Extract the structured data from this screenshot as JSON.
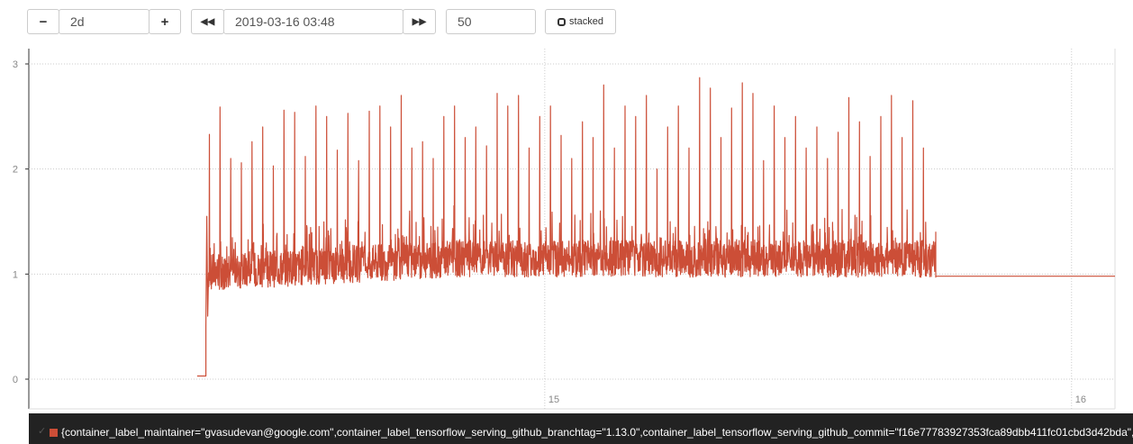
{
  "controls": {
    "range_minus_label": "−",
    "range_value": "2d",
    "range_plus_label": "+",
    "time_back_label": "◀◀",
    "end_time_value": "2019-03-16 03:48",
    "time_forward_label": "▶▶",
    "resolution_value": "50",
    "stacked_label": "stacked"
  },
  "legend": {
    "check_icon": "check-icon",
    "series_label": "{container_label_maintainer=\"gvasudevan@google.com\",container_label_tensorflow_serving_github_branchtag=\"1.13.0\",container_label_tensorflow_serving_github_commit=\"f16e77783927353fca89dbb411fc01cbd3d42bda\","
  },
  "colors": {
    "series": "#cc4e37",
    "grid": "#cccccc",
    "legend_bg": "#222222"
  },
  "chart_data": {
    "type": "line",
    "ylim": [
      0,
      3
    ],
    "yticks": [
      "0",
      "1",
      "2",
      "3"
    ],
    "xticks": [
      "15",
      "16"
    ],
    "x_tick_positions": [
      0.475,
      0.96
    ],
    "grid": true,
    "legend_position": "bottom",
    "description_free": true,
    "series": [
      {
        "segments": [
          {
            "x_start": 0.155,
            "x_end": 0.163,
            "baseline": 0.03,
            "jitter": 0
          },
          {
            "x_start": 0.163,
            "x_end": 0.835,
            "baseline_start": 0.92,
            "baseline_end": 1.05,
            "band": 0.35,
            "spikes": [
              2.33,
              2.59,
              2.1,
              2.06,
              2.26,
              2.4,
              2.03,
              2.56,
              2.54,
              2.12,
              2.6,
              2.5,
              2.18,
              2.53,
              2.08,
              2.55,
              2.6,
              2.4,
              2.7,
              2.2,
              2.26,
              2.1,
              2.5,
              2.6,
              2.3,
              2.4,
              2.22,
              2.72,
              2.6,
              2.7,
              2.2,
              2.5,
              2.6,
              2.32,
              2.1,
              2.45,
              2.3,
              2.8,
              2.2,
              2.6,
              2.5,
              2.7,
              2.0,
              2.4,
              2.6,
              2.2,
              2.87,
              2.77,
              2.3,
              2.58,
              2.82,
              2.72,
              2.08,
              2.6,
              2.3,
              2.5,
              2.2,
              2.4,
              2.1,
              2.35,
              2.68,
              2.45,
              2.12,
              2.5,
              2.7,
              2.3,
              2.65,
              2.2
            ]
          },
          {
            "x_start": 0.835,
            "x_end": 1.0,
            "baseline": 0.98,
            "jitter": 0
          }
        ]
      }
    ]
  }
}
